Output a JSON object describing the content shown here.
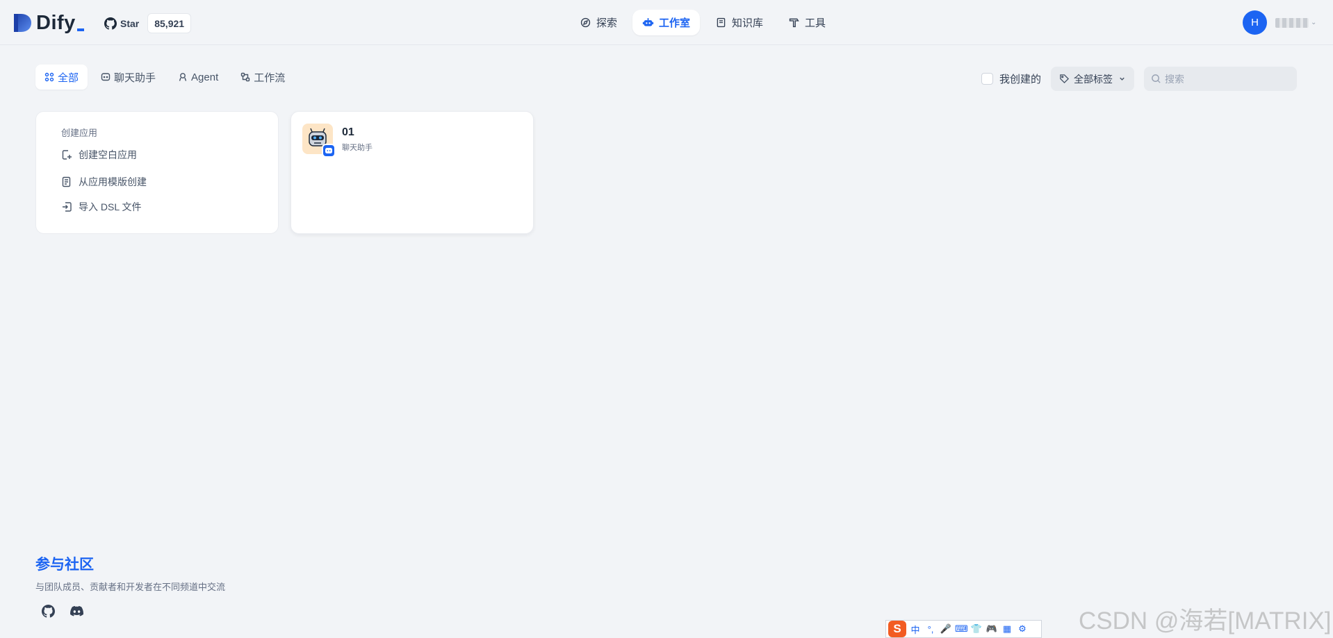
{
  "header": {
    "logo_text": "Dify",
    "github": {
      "star_label": "Star",
      "star_count": "85,921"
    },
    "nav": [
      {
        "label": "探索",
        "icon": "compass-icon",
        "active": false
      },
      {
        "label": "工作室",
        "icon": "robot-icon",
        "active": true
      },
      {
        "label": "知识库",
        "icon": "book-icon",
        "active": false
      },
      {
        "label": "工具",
        "icon": "hammer-icon",
        "active": false
      }
    ],
    "user": {
      "avatar_initial": "H"
    }
  },
  "tabs": [
    {
      "label": "全部",
      "icon": "grid-icon",
      "active": true
    },
    {
      "label": "聊天助手",
      "icon": "chat-icon",
      "active": false
    },
    {
      "label": "Agent",
      "icon": "agent-icon",
      "active": false
    },
    {
      "label": "工作流",
      "icon": "workflow-icon",
      "active": false
    }
  ],
  "filters": {
    "mine_label": "我创建的",
    "mine_checked": false,
    "tag_label": "全部标签",
    "search_placeholder": "搜索"
  },
  "create_card": {
    "title": "创建应用",
    "items": [
      {
        "label": "创建空白应用",
        "icon": "blank-file-icon"
      },
      {
        "label": "从应用模版创建",
        "icon": "template-icon"
      },
      {
        "label": "导入 DSL 文件",
        "icon": "import-icon"
      }
    ]
  },
  "apps": [
    {
      "name": "01",
      "type": "聊天助手",
      "icon": "robot-avatar-icon",
      "badge_icon": "chat-badge-icon"
    }
  ],
  "community": {
    "title": "参与社区",
    "description": "与团队成员、贡献者和开发者在不同频道中交流",
    "links": [
      "github-icon",
      "discord-icon"
    ]
  },
  "ime_toolbar": {
    "logo": "S",
    "items": [
      "中",
      "°,",
      "🎤",
      "⌨",
      "👕",
      "🎮",
      "▦",
      "⚙"
    ]
  },
  "watermark": "CSDN @海若[MATRIX]",
  "colors": {
    "accent": "#1c64f2",
    "background": "#f2f4f7",
    "card": "#ffffff"
  }
}
